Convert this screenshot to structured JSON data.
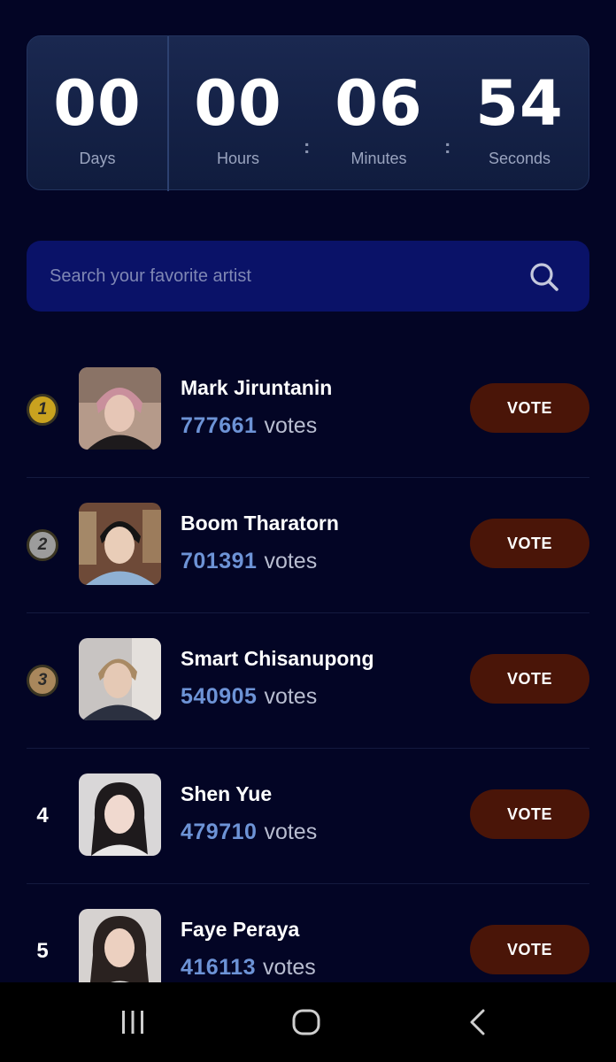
{
  "colors": {
    "accent_vote_count": "#6d93d6",
    "vote_button_bg": "#4a1508",
    "gold": "#c9a21f",
    "silver": "#9c9c9c",
    "bronze": "#a9875c"
  },
  "countdown": {
    "cells": [
      {
        "value": "00",
        "label": "Days"
      },
      {
        "value": "00",
        "label": "Hours"
      },
      {
        "value": "06",
        "label": "Minutes"
      },
      {
        "value": "54",
        "label": "Seconds"
      }
    ],
    "separator": ":"
  },
  "search": {
    "placeholder": "Search your favorite artist",
    "value": "",
    "icon": "search-icon"
  },
  "ranking": [
    {
      "rank": "1",
      "badge": "gold",
      "name": "Mark Jiruntanin",
      "votes": "777661",
      "votes_label": "votes",
      "button": "VOTE"
    },
    {
      "rank": "2",
      "badge": "silver",
      "name": "Boom Tharatorn",
      "votes": "701391",
      "votes_label": "votes",
      "button": "VOTE"
    },
    {
      "rank": "3",
      "badge": "bronze",
      "name": "Smart Chisanupong",
      "votes": "540905",
      "votes_label": "votes",
      "button": "VOTE"
    },
    {
      "rank": "4",
      "badge": "none",
      "name": "Shen Yue",
      "votes": "479710",
      "votes_label": "votes",
      "button": "VOTE"
    },
    {
      "rank": "5",
      "badge": "none",
      "name": "Faye Peraya",
      "votes": "416113",
      "votes_label": "votes",
      "button": "VOTE"
    }
  ],
  "navbar": {
    "buttons": [
      "recent-apps-icon",
      "home-icon",
      "back-icon"
    ]
  }
}
